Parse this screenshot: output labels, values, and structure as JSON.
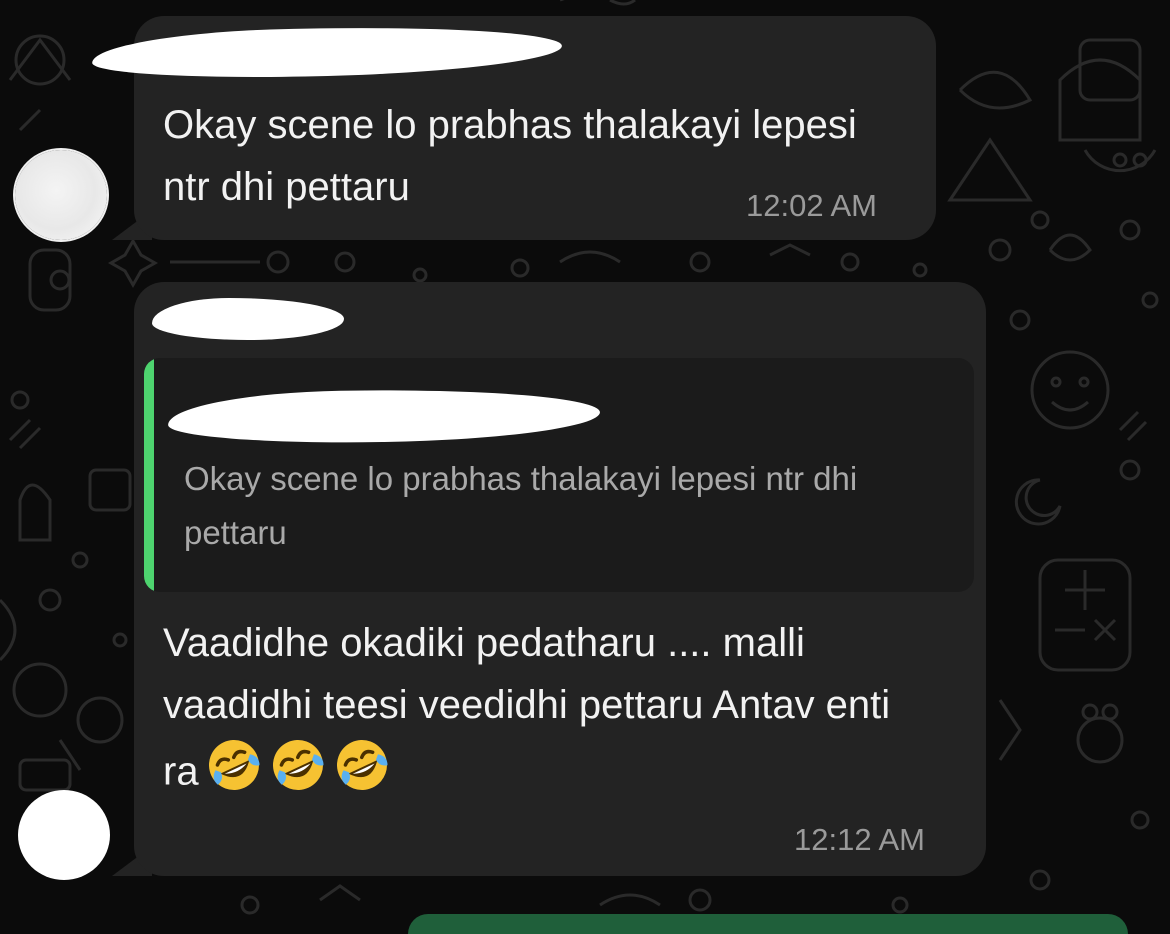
{
  "colors": {
    "background": "#0b0b0b",
    "bubble_incoming": "#232323",
    "quote_background": "#1b1b1b",
    "quote_accent": "#4ed46f",
    "text_primary": "#f2f2f2",
    "text_secondary": "#9a9a9a"
  },
  "messages": [
    {
      "text": "Okay scene lo prabhas thalakayi lepesi ntr dhi pettaru",
      "time": "12:02 AM"
    },
    {
      "quote": {
        "text": "Okay scene lo prabhas thalakayi lepesi ntr dhi pettaru"
      },
      "text": "Vaadidhe okadiki pedatharu .... malli vaadidhi teesi veedidhi pettaru Antav enti ra",
      "emojis": [
        "rolling-on-floor-laughing",
        "rolling-on-floor-laughing",
        "rolling-on-floor-laughing"
      ],
      "time": "12:12 AM"
    }
  ]
}
